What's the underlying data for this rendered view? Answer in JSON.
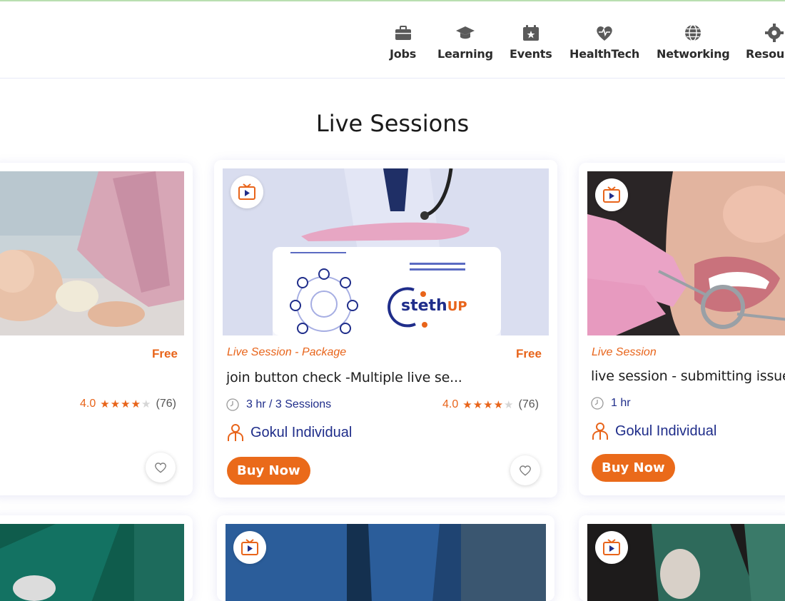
{
  "nav": {
    "items": [
      {
        "label": "Jobs",
        "icon": "briefcase-icon"
      },
      {
        "label": "Learning",
        "icon": "graduation-cap-icon"
      },
      {
        "label": "Events",
        "icon": "calendar-star-icon"
      },
      {
        "label": "HealthTech",
        "icon": "heart-pulse-icon"
      },
      {
        "label": "Networking",
        "icon": "globe-icon"
      },
      {
        "label": "Resour",
        "icon": "gear-icon"
      }
    ]
  },
  "section": {
    "title": "Live Sessions"
  },
  "cards": [
    {
      "price": "Free",
      "rating": "4.0",
      "stars": 4,
      "count": "(76)"
    },
    {
      "category": "Live Session - Package",
      "price": "Free",
      "title": "join button check -Multiple live se...",
      "duration": "3 hr / 3 Sessions",
      "rating": "4.0",
      "stars": 4,
      "count": "(76)",
      "author": "Gokul Individual",
      "buy_label": "Buy Now",
      "image_logo": "stethUP"
    },
    {
      "category": "Live Session",
      "title": "live session - submitting issue",
      "duration": "1 hr",
      "author": "Gokul Individual",
      "buy_label": "Buy Now"
    }
  ],
  "colors": {
    "accent": "#e8641a",
    "navy": "#1f2d8a",
    "badge_icon": "#e8641a"
  }
}
